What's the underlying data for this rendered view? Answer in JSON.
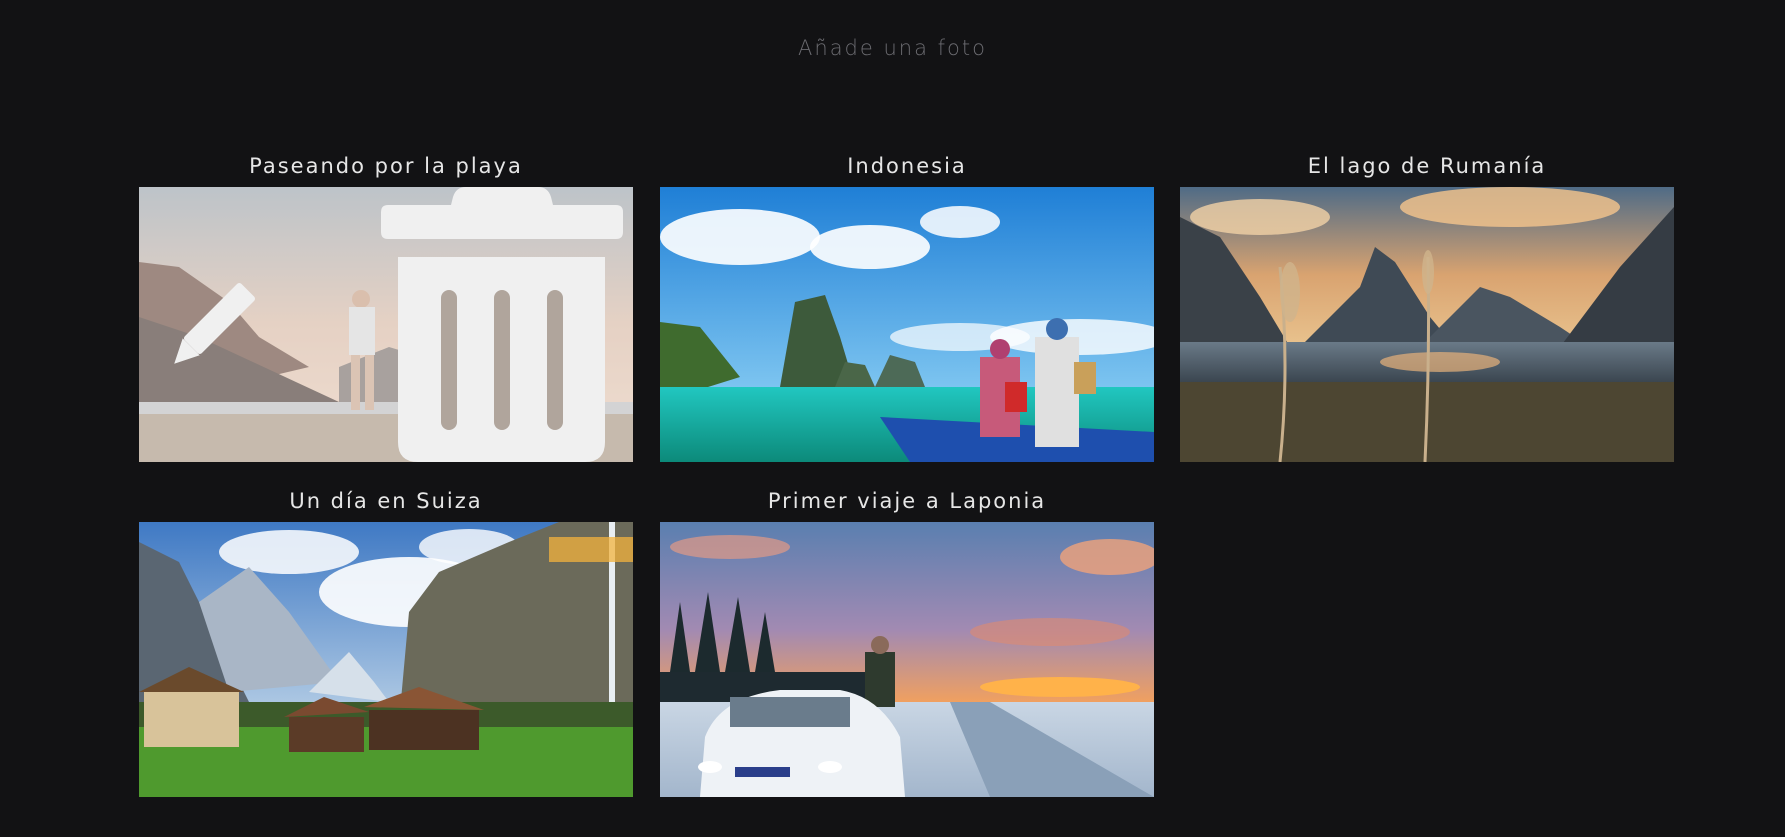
{
  "header": {
    "add_photo_label": "Añade una foto"
  },
  "photos": [
    {
      "title": "Paseando por la playa",
      "image": "beach-traveler"
    },
    {
      "title": "Indonesia",
      "image": "indonesia-boat"
    },
    {
      "title": "El lago de Rumanía",
      "image": "mountain-lake"
    },
    {
      "title": "Un día en Suiza",
      "image": "swiss-valley"
    },
    {
      "title": "Primer viaje a Laponia",
      "image": "lapland-car"
    }
  ],
  "card_actions": {
    "edit_icon": "pencil-icon",
    "delete_icon": "trash-icon"
  },
  "colors": {
    "background": "#121214",
    "title_text": "#e6e6e6",
    "add_photo_text": "#6b6b70",
    "action_icon": "#f0f0f0"
  }
}
